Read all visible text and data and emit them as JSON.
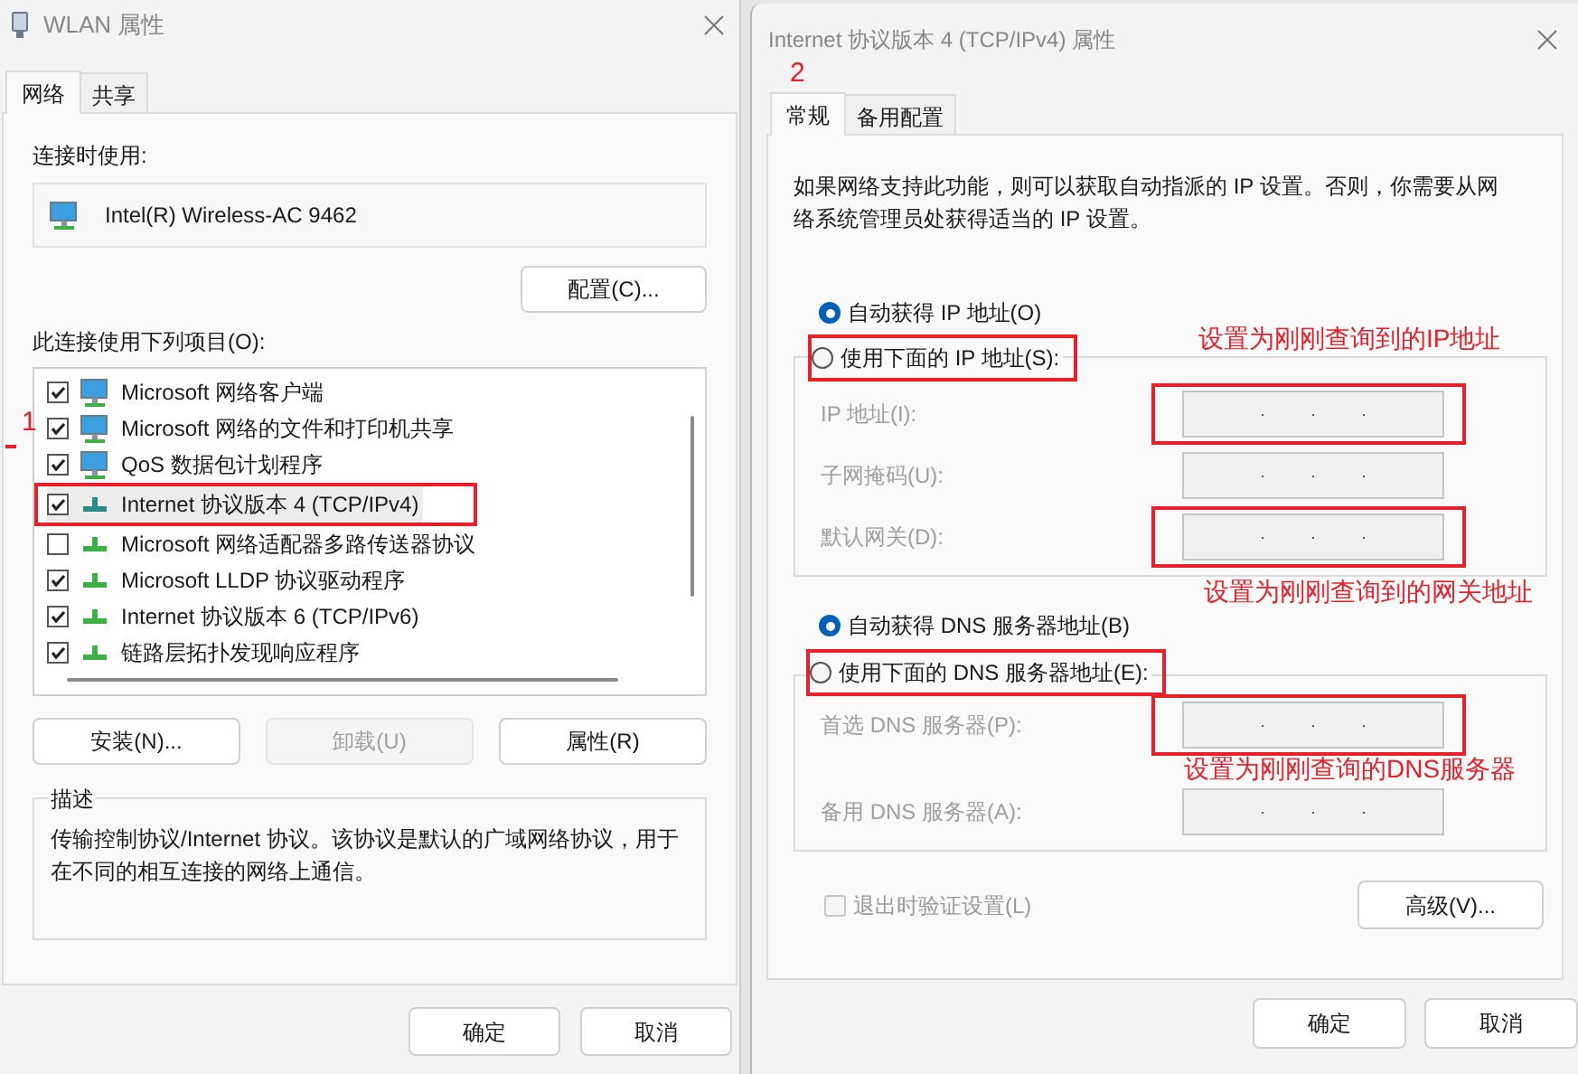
{
  "wlan_window": {
    "title": "WLAN 属性",
    "tabs": [
      {
        "label": "网络",
        "selected": true
      },
      {
        "label": "共享",
        "selected": false
      }
    ],
    "connect_using_label": "连接时使用:",
    "adapter": "Intel(R) Wireless-AC 9462",
    "configure_button": "配置(C)...",
    "items_label": "此连接使用下列项目(O):",
    "items": [
      {
        "label": "Microsoft 网络客户端",
        "checked": true,
        "kind": "service",
        "selected": false,
        "annotated": false
      },
      {
        "label": "Microsoft 网络的文件和打印机共享",
        "checked": true,
        "kind": "service",
        "selected": false,
        "annotated": false
      },
      {
        "label": "QoS 数据包计划程序",
        "checked": true,
        "kind": "service",
        "selected": false,
        "annotated": false
      },
      {
        "label": "Internet 协议版本 4 (TCP/IPv4)",
        "checked": true,
        "kind": "protocol",
        "selected": true,
        "annotated": true
      },
      {
        "label": "Microsoft 网络适配器多路传送器协议",
        "checked": false,
        "kind": "protocol",
        "selected": false,
        "annotated": false
      },
      {
        "label": "Microsoft LLDP 协议驱动程序",
        "checked": true,
        "kind": "protocol",
        "selected": false,
        "annotated": false
      },
      {
        "label": "Internet 协议版本 6 (TCP/IPv6)",
        "checked": true,
        "kind": "protocol",
        "selected": false,
        "annotated": false
      },
      {
        "label": "链路层拓扑发现响应程序",
        "checked": true,
        "kind": "protocol",
        "selected": false,
        "annotated": false
      }
    ],
    "item_buttons": [
      {
        "label": "安装(N)...",
        "disabled": false
      },
      {
        "label": "卸载(U)",
        "disabled": true
      },
      {
        "label": "属性(R)",
        "disabled": false
      }
    ],
    "description_title": "描述",
    "description": "传输控制协议/Internet 协议。该协议是默认的广域网络协议，用于在不同的相互连接的网络上通信。",
    "footer_buttons": [
      "确定",
      "取消"
    ]
  },
  "ipv4_window": {
    "title": "Internet 协议版本 4 (TCP/IPv4) 属性",
    "tabs": [
      {
        "label": "常规",
        "selected": true
      },
      {
        "label": "备用配置",
        "selected": false
      }
    ],
    "intro": "如果网络支持此功能，则可以获取自动指派的 IP 设置。否则，你需要从网络系统管理员处获得适当的 IP 设置。",
    "ip_mode": [
      {
        "label": "自动获得 IP 地址(O)",
        "selected": true,
        "annotated": false
      },
      {
        "label": "使用下面的 IP 地址(S):",
        "selected": false,
        "annotated": true
      }
    ],
    "ip_fields": [
      {
        "label": "IP 地址(I):",
        "disabled": true,
        "annotated": true
      },
      {
        "label": "子网掩码(U):",
        "disabled": true,
        "annotated": false
      },
      {
        "label": "默认网关(D):",
        "disabled": true,
        "annotated": true
      }
    ],
    "dns_mode": [
      {
        "label": "自动获得 DNS 服务器地址(B)",
        "selected": true,
        "annotated": false
      },
      {
        "label": "使用下面的 DNS 服务器地址(E):",
        "selected": false,
        "annotated": true
      }
    ],
    "dns_fields": [
      {
        "label": "首选 DNS 服务器(P):",
        "disabled": true,
        "annotated": true
      },
      {
        "label": "备用 DNS 服务器(A):",
        "disabled": true,
        "annotated": false
      }
    ],
    "validate_checkbox": {
      "label": "退出时验证设置(L)",
      "checked": false,
      "disabled": true
    },
    "advanced_button": "高级(V)...",
    "footer_buttons": [
      "确定",
      "取消"
    ]
  },
  "annotations": [
    {
      "kind": "step",
      "text": "1"
    },
    {
      "kind": "step",
      "text": "2"
    },
    {
      "kind": "note",
      "text": "设置为刚刚查询到的IP地址"
    },
    {
      "kind": "note",
      "text": "设置为刚刚查询到的网关地址"
    },
    {
      "kind": "note",
      "text": "设置为刚刚查询的DNS服务器"
    }
  ]
}
